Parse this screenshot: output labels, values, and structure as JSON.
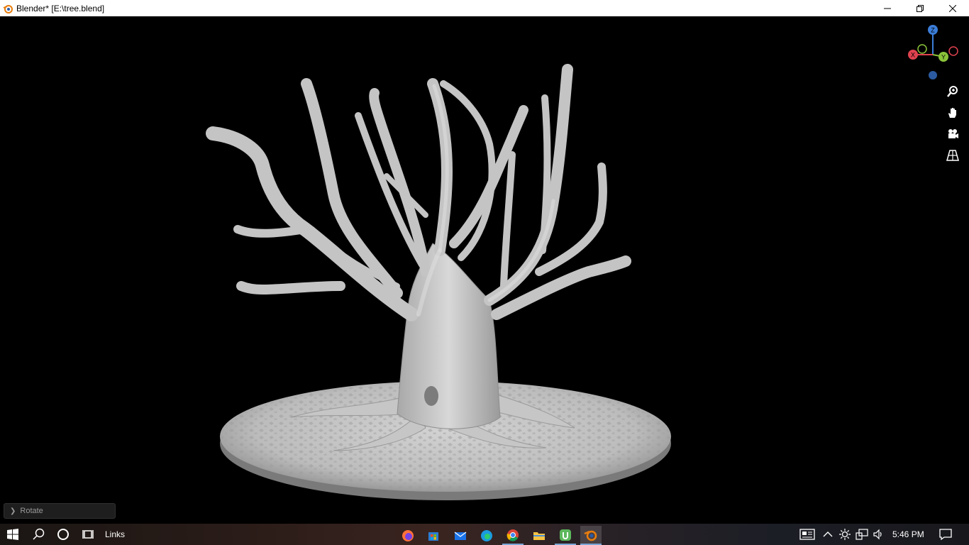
{
  "window": {
    "title": "Blender* [E:\\tree.blend]",
    "controls": [
      "minimize-icon",
      "restore-icon",
      "close-icon"
    ]
  },
  "viewport": {
    "gizmo": {
      "z_label": "Z",
      "x_label": "X",
      "y_label": "Y",
      "colors": {
        "x": "#e0424f",
        "y": "#8bc43a",
        "z": "#3b7dd8"
      }
    },
    "nav_tools": [
      "zoom-icon",
      "hand-pan-icon",
      "camera-icon",
      "grid-perspective-icon"
    ],
    "operator_panel": {
      "label": "Rotate"
    },
    "object": "tree-sculpt-on-base"
  },
  "taskbar": {
    "links_label": "Links",
    "apps": [
      "firefox-icon",
      "store-icon",
      "mail-icon",
      "edge-icon",
      "chrome-icon",
      "file-explorer-icon",
      "utorrent-icon",
      "blender-icon"
    ],
    "tray": [
      "news-icon",
      "chevron-up-icon",
      "brightness-icon",
      "network-icon",
      "volume-icon"
    ],
    "time": "5:46 PM"
  }
}
